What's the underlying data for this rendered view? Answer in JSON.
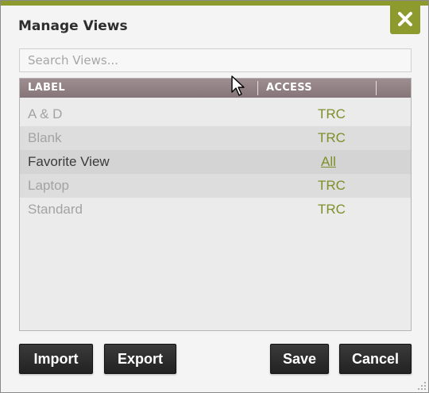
{
  "dialog": {
    "title": "Manage Views",
    "close_icon": "close-x-icon",
    "accent_color": "#8c9a2e"
  },
  "search": {
    "placeholder": "Search Views...",
    "value": ""
  },
  "table": {
    "columns": [
      "LABEL",
      "ACCESS"
    ],
    "header_color": "#857479",
    "rows": [
      {
        "label": "A & D",
        "access": "TRC"
      },
      {
        "label": "Blank",
        "access": "TRC"
      },
      {
        "label": "Favorite View",
        "access": "All",
        "selected": true
      },
      {
        "label": "Laptop",
        "access": "TRC"
      },
      {
        "label": "Standard",
        "access": "TRC"
      }
    ]
  },
  "buttons": {
    "import": "Import",
    "export": "Export",
    "save": "Save",
    "cancel": "Cancel"
  }
}
